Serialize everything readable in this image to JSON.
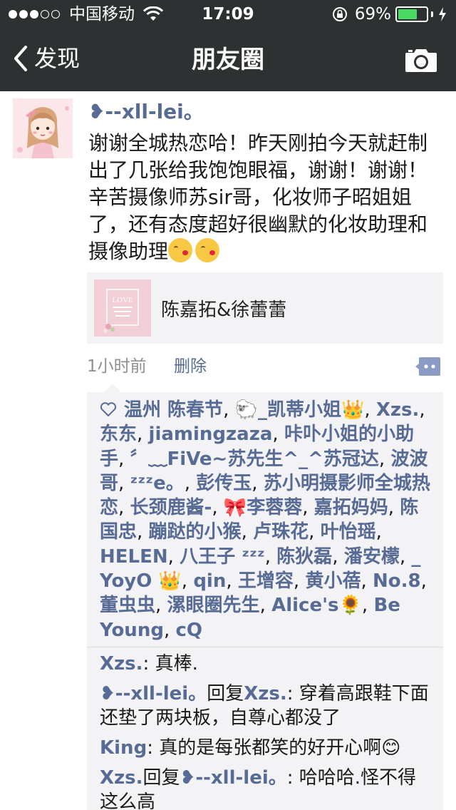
{
  "status_bar": {
    "carrier": "中国移动",
    "time": "17:09",
    "battery": "69%",
    "battery_level": 0.69,
    "signal_bars_filled": 3,
    "signal_bars_total": 5
  },
  "nav": {
    "back_label": "发现",
    "title": "朋友圈",
    "right_icon": "camera-icon"
  },
  "post": {
    "author": "❥--xll-lei。",
    "text": "谢谢全城热恋哈！昨天刚拍今天就赶制出了几张给我饱饱眼福，谢谢！谢谢！辛苦摄像师苏sir哥，化妆师子昭姐姐了，还有态度超好很幽默的化妆助理和摄像助理",
    "emoji_count": 2,
    "link_card": {
      "title": "陈嘉拓&徐蕾蕾",
      "thumb_text": "LOVE"
    },
    "time": "1小时前",
    "delete_label": "删除"
  },
  "likes": [
    "温州 陈春节",
    "🐑_凯蒂小姐👑",
    "Xzs.",
    "东东",
    "jiamingzaza",
    "咔卟小姐的小助手",
    "〞﹏FiVe~苏先生^_^苏冠达",
    "波波哥",
    "ᶻᶻᶻe。",
    "彭传玉",
    "苏小明摄影师全城热恋",
    "长颈鹿酱-",
    "🎀李蓉蓉",
    "嘉拓妈妈",
    "陈国忠",
    "蹦跶的小猴",
    "卢珠花",
    "叶怡瑶",
    "HELEN",
    "八王子 ᶻᶻᶻ",
    "陈狄磊",
    "潘安檬",
    "_ YoyO 👑",
    "qin",
    "王增容",
    "黄小蓓",
    "No.8",
    "董虫虫",
    "漯眼圈先生",
    "Alice's🌻",
    "Be Young",
    "cQ"
  ],
  "comments": [
    {
      "from": "Xzs.",
      "to": "",
      "text": "真棒."
    },
    {
      "from": "❥--xll-lei。",
      "to": "Xzs.",
      "reply_word": "回复",
      "text": "穿着高跟鞋下面还垫了两块板，自尊心都没了"
    },
    {
      "from": "King",
      "to": "",
      "text": "真的是每张都笑的好开心啊😊"
    },
    {
      "from": "Xzs.",
      "to": "❥--xll-lei。",
      "reply_word": "回复",
      "text": "哈哈哈.怪不得这么高"
    }
  ],
  "colors": {
    "bar_bg": "#2e3132",
    "name_blue": "#576b95",
    "box_bg": "#f3f3f5",
    "battery_green": "#4cd964"
  }
}
